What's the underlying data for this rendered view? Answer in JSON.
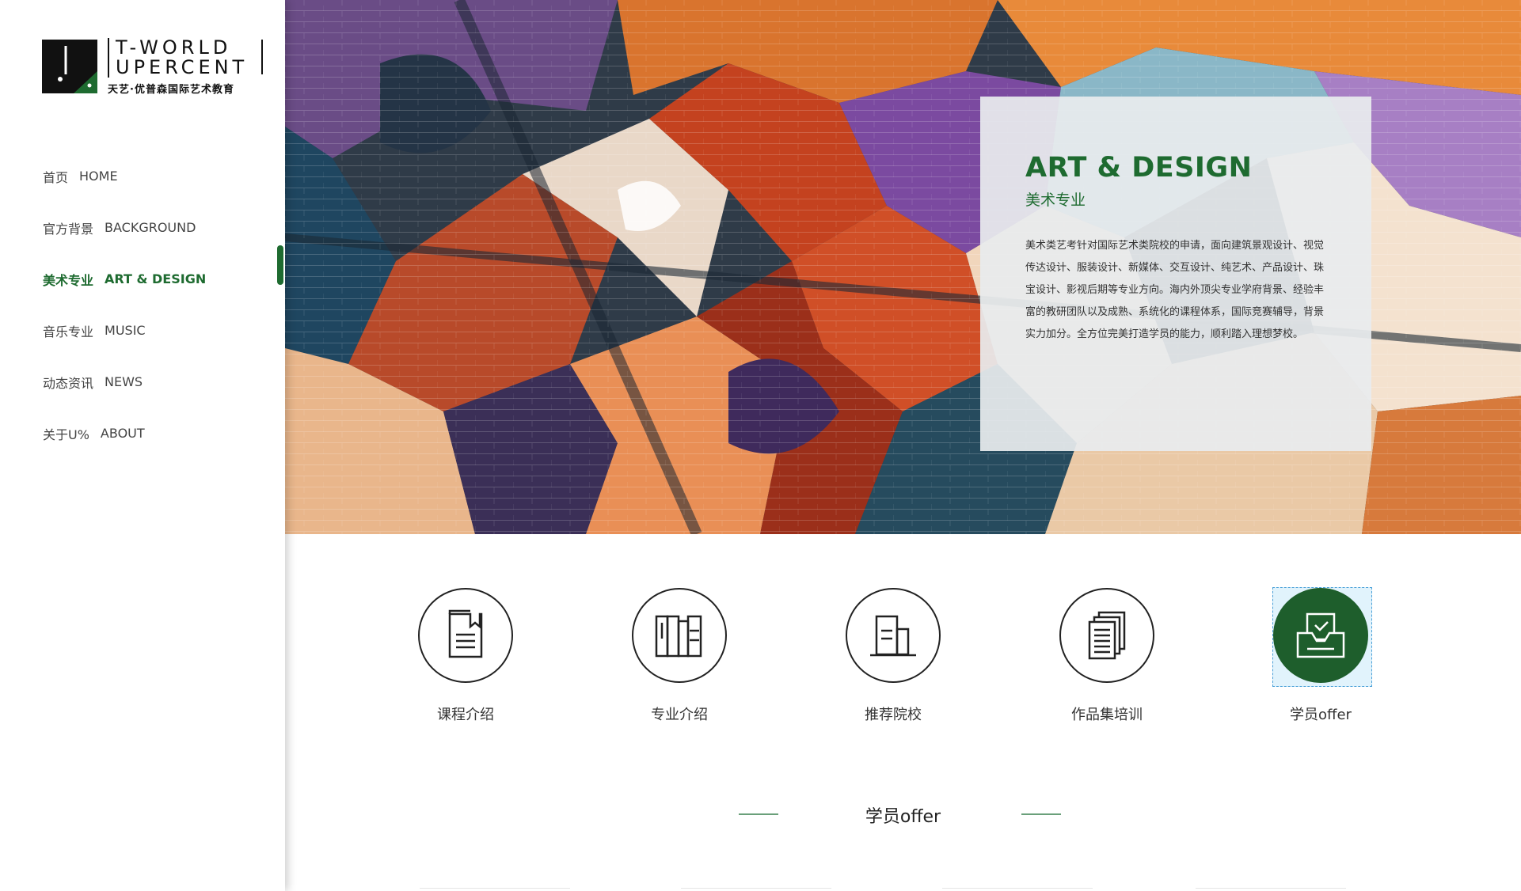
{
  "brand": {
    "name_line1": "T-WORLD",
    "name_line2": "UPERCENT",
    "tagline": "天艺·优普森国际艺术教育",
    "accent_color": "#1e6b30"
  },
  "nav": {
    "items": [
      {
        "zh": "首页",
        "en": "HOME"
      },
      {
        "zh": "官方背景",
        "en": "BACKGROUND"
      },
      {
        "zh": "美术专业",
        "en": "ART & DESIGN"
      },
      {
        "zh": "音乐专业",
        "en": "MUSIC"
      },
      {
        "zh": "动态资讯",
        "en": "NEWS"
      },
      {
        "zh": "关于U%",
        "en": "ABOUT"
      }
    ],
    "active_index": 2
  },
  "hero": {
    "title": "ART & DESIGN",
    "subtitle": "美术专业",
    "description": "美术类艺考针对国际艺术类院校的申请，面向建筑景观设计、视觉传达设计、服装设计、新媒体、交互设计、纯艺术、产品设计、珠宝设计、影视后期等专业方向。海内外顶尖专业学府背景、经验丰富的教研团队以及成熟、系统化的课程体系，国际竞赛辅导，背景实力加分。全方位完美打造学员的能力，顺利踏入理想梦校。"
  },
  "features": [
    {
      "label": "课程介绍",
      "icon": "booklet-icon"
    },
    {
      "label": "专业介绍",
      "icon": "books-icon"
    },
    {
      "label": "推荐院校",
      "icon": "building-icon"
    },
    {
      "label": "作品集培训",
      "icon": "portfolio-stack-icon"
    },
    {
      "label": "学员offer",
      "icon": "offer-tray-icon",
      "active": true
    }
  ],
  "section": {
    "title": "学员offer"
  }
}
